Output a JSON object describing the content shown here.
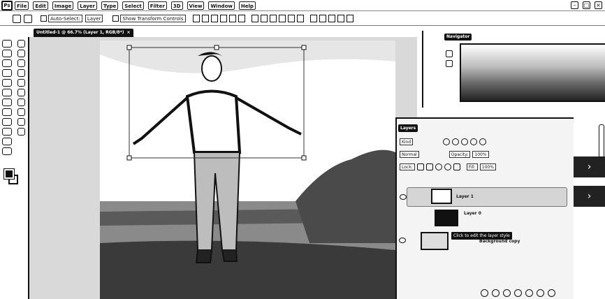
{
  "menu": {
    "app_logo": "Ps",
    "items": [
      "File",
      "Edit",
      "Image",
      "Layer",
      "Type",
      "Select",
      "Filter",
      "3D",
      "View",
      "Window",
      "Help"
    ]
  },
  "window_controls": {
    "minimize": "–",
    "maximize": "□",
    "close": "×"
  },
  "options_bar": {
    "auto_select_label": "Auto-Select:",
    "auto_select_value": "Layer",
    "show_transform_label": "Show Transform Controls"
  },
  "document_tab": {
    "title": "Untitled-1 @ 66.7% (Layer 1, RGB/8*)",
    "close": "×"
  },
  "navigator": {
    "tab": "Navigator"
  },
  "layers": {
    "tab": "Layers",
    "kind_label": "Kind",
    "mode_value": "Normal",
    "opacity_label": "Opacity:",
    "opacity_value": "100%",
    "lock_label": "Lock:",
    "fill_label": "Fill:",
    "fill_value": "100%",
    "items": [
      {
        "name": "Layer 1",
        "selected": true
      },
      {
        "name": "Layer 0"
      },
      {
        "name": "Background copy"
      }
    ],
    "tooltip": "Click to edit the layer style"
  },
  "side_panel": {
    "expand_arrow_1": "›",
    "expand_arrow_2": "›"
  },
  "colors": {
    "ink": "#111111",
    "panel": "#f4f4f4",
    "workspace": "#d9d9d9",
    "accent": "#222222"
  }
}
